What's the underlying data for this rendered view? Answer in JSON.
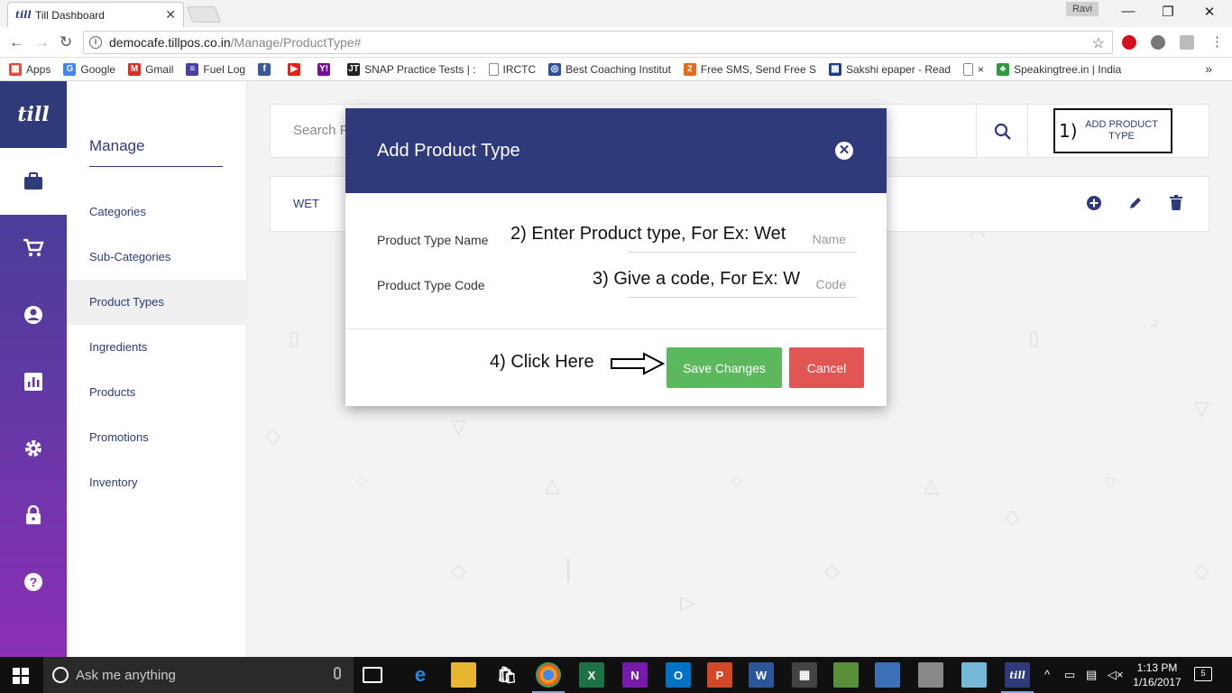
{
  "browser": {
    "tab_title": "Till Dashboard",
    "tab_favicon": "till",
    "user_badge": "Ravi",
    "url_host": "democafe.tillpos.co.in",
    "url_path": "/Manage/ProductType#",
    "bookmarks": [
      {
        "label": "Apps",
        "icon": "apps-grid-icon",
        "color": "#e24a3b"
      },
      {
        "label": "Google",
        "icon": "google-icon",
        "color": "#4285f4"
      },
      {
        "label": "Gmail",
        "icon": "gmail-icon",
        "color": "#d93025"
      },
      {
        "label": "Fuel Log",
        "icon": "fuel-log-icon",
        "color": "#4b3fa0"
      },
      {
        "label": "",
        "icon": "facebook-icon",
        "color": "#3b5998"
      },
      {
        "label": "",
        "icon": "youtube-icon",
        "color": "#e62117"
      },
      {
        "label": "",
        "icon": "yahoo-icon",
        "color": "#720e9e"
      },
      {
        "label": "SNAP Practice Tests | :",
        "icon": "jt-icon",
        "color": "#222222"
      },
      {
        "label": "IRCTC",
        "icon": "page-icon",
        "color": "#888888"
      },
      {
        "label": "Best Coaching Institut",
        "icon": "coaching-icon",
        "color": "#2d4f9e"
      },
      {
        "label": "Free SMS, Send Free S",
        "icon": "way2sms-icon",
        "color": "#e56b1f"
      },
      {
        "label": "Sakshi epaper - Read",
        "icon": "sakshi-icon",
        "color": "#1d3f8c"
      },
      {
        "label": "×",
        "icon": "page-icon",
        "color": "#888888"
      },
      {
        "label": "Speakingtree.in | India",
        "icon": "tree-icon",
        "color": "#2f9a3c"
      }
    ],
    "bookmarks_more": "»"
  },
  "app": {
    "logo": "till",
    "rail_icons": [
      "briefcase-icon",
      "cart-icon",
      "user-circle-icon",
      "bar-chart-icon",
      "settings-gear-icon",
      "lock-icon",
      "help-icon"
    ],
    "active_rail": 0,
    "manage": {
      "title": "Manage",
      "items": [
        {
          "label": "Categories"
        },
        {
          "label": "Sub-Categories"
        },
        {
          "label": "Product Types"
        },
        {
          "label": "Ingredients"
        },
        {
          "label": "Products"
        },
        {
          "label": "Promotions"
        },
        {
          "label": "Inventory"
        }
      ],
      "active_index": 2
    },
    "search": {
      "placeholder": "Search P"
    },
    "add_button": {
      "annotation": "1)",
      "label_line1": "ADD PRODUCT",
      "label_line2": "TYPE"
    },
    "rows": [
      {
        "name": "WET"
      }
    ]
  },
  "modal": {
    "title": "Add Product Type",
    "fields": [
      {
        "label": "Product Type Name",
        "annotation": "2) Enter Product type, For Ex: Wet",
        "placeholder": "Name",
        "value": ""
      },
      {
        "label": "Product Type Code",
        "annotation": "3) Give a code, For Ex: W",
        "placeholder": "Code",
        "value": ""
      }
    ],
    "click_annotation": "4) Click  Here",
    "save_label": "Save Changes",
    "cancel_label": "Cancel"
  },
  "taskbar": {
    "search_placeholder": "Ask me anything",
    "time": "1:13 PM",
    "date": "1/16/2017",
    "notifications": "5"
  },
  "colors": {
    "brand": "#2e3a7a",
    "save": "#5cb85c",
    "cancel": "#e15555"
  }
}
